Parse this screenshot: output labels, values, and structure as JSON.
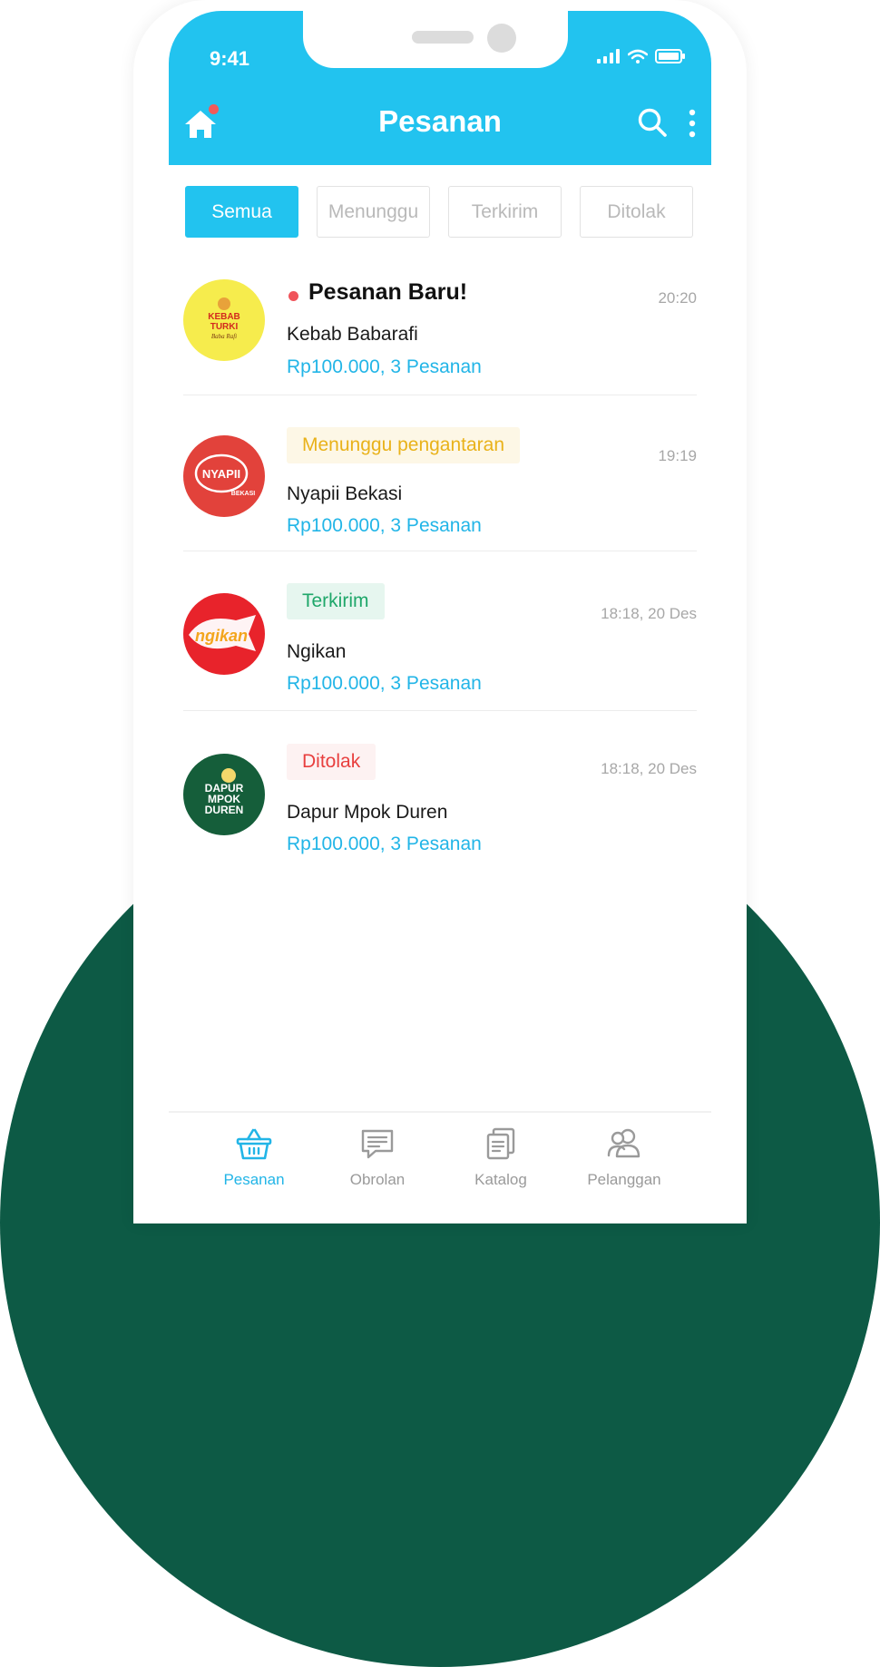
{
  "status_bar": {
    "time": "9:41"
  },
  "header": {
    "title": "Pesanan"
  },
  "tabs": [
    {
      "label": "Semua",
      "active": true
    },
    {
      "label": "Menunggu",
      "active": false
    },
    {
      "label": "Terkirim",
      "active": false
    },
    {
      "label": "Ditolak",
      "active": false
    }
  ],
  "orders": [
    {
      "title": "Pesanan Baru!",
      "time": "20:20",
      "store": "Kebab Babarafi",
      "summary": "Rp100.000, 3 Pesanan",
      "logo_text": [
        "KEBAB",
        "TURKI",
        "Baba Rafi"
      ],
      "logo_color": "#f6ec4d"
    },
    {
      "status": "Menunggu pengantaran",
      "status_color": "#e9b21a",
      "time": "19:19",
      "store": "Nyapii Bekasi",
      "summary": "Rp100.000, 3 Pesanan",
      "logo_text": [
        "NYAPII",
        "BEKASI"
      ],
      "logo_color": "#e2423b"
    },
    {
      "status": "Terkirim",
      "status_color": "#1fa76a",
      "time": "18:18, 20 Des",
      "store": "Ngikan",
      "summary": "Rp100.000, 3 Pesanan",
      "logo_text": [
        "ngikan"
      ],
      "logo_color": "#e8232b"
    },
    {
      "status": "Ditolak",
      "status_color": "#e8403f",
      "time": "18:18, 20 Des",
      "store": "Dapur Mpok Duren",
      "summary": "Rp100.000, 3 Pesanan",
      "logo_text": [
        "DAPUR",
        "MPOK",
        "DUREN"
      ],
      "logo_color": "#155e3a"
    }
  ],
  "bottom_nav": [
    {
      "label": "Pesanan",
      "icon": "basket-icon",
      "active": true
    },
    {
      "label": "Obrolan",
      "icon": "chat-icon",
      "active": false
    },
    {
      "label": "Katalog",
      "icon": "catalog-icon",
      "active": false
    },
    {
      "label": "Pelanggan",
      "icon": "customers-icon",
      "active": false
    }
  ],
  "colors": {
    "primary": "#22c3ef",
    "accent_text": "#22b5e7",
    "background_shape": "#0d5a45"
  }
}
